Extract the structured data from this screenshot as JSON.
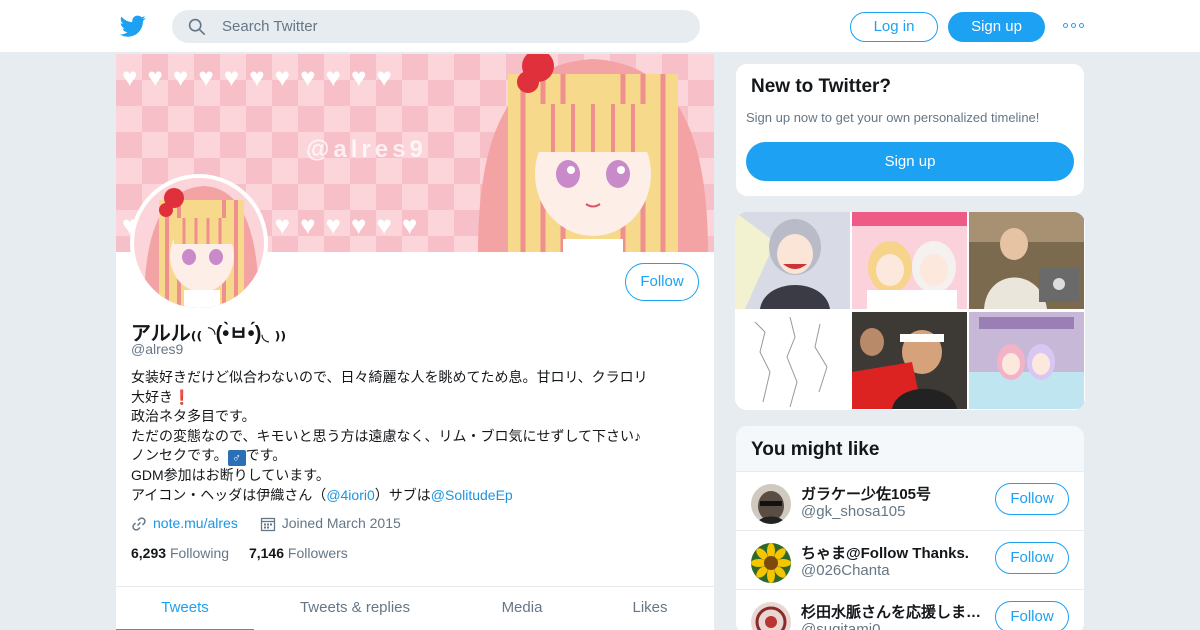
{
  "colors": {
    "accent": "#1da1f2",
    "link": "#1b95e0",
    "muted": "#657786",
    "text": "#14171a",
    "background": "#e6ecf0"
  },
  "topbar": {
    "logo_icon": "twitter-bird-icon",
    "search_placeholder": "Search Twitter",
    "login_label": "Log in",
    "signup_label": "Sign up",
    "more_icon": "more-dots-icon"
  },
  "banner": {
    "watermark": "@alres9"
  },
  "profile": {
    "follow_label": "Follow",
    "name": "アルル₍₍ ◝(•̀ㅂ•́)◟ ₎₎",
    "handle": "@alres9",
    "bio": {
      "line1": "女装好きだけど似合わないので、日々綺麗な人を眺めてため息。甘ロリ、クラロリ",
      "line2": "大好き",
      "line2_emoji": "❗",
      "line3": "政治ネタ多目です。",
      "line4": "ただの変態なので、キモいと思う方は遠慮なく、リム・ブロ気にせずして下さい♪",
      "line5a": "ノンセクです。",
      "line5_emoji": "♂",
      "line5b": "です。",
      "line6": "GDM参加はお断りしています。",
      "line7a": "アイコン・ヘッダは伊織さん（",
      "line7_link1": "@4iori0",
      "line7b": "）サブは",
      "line7_link2": "@SolitudeEp"
    },
    "website": "note.mu/alres",
    "joined": "Joined March 2015",
    "following_count": "6,293",
    "following_label": "Following",
    "followers_count": "7,146",
    "followers_label": "Followers"
  },
  "tabs": [
    {
      "label": "Tweets",
      "active": true
    },
    {
      "label": "Tweets & replies",
      "active": false
    },
    {
      "label": "Media",
      "active": false
    },
    {
      "label": "Likes",
      "active": false
    }
  ],
  "new_to_twitter": {
    "title": "New to Twitter?",
    "subtitle": "Sign up now to get your own personalized timeline!",
    "button": "Sign up"
  },
  "media_thumbs": [
    {
      "name": "media-thumb-anime-girl"
    },
    {
      "name": "media-thumb-nurse-girls-poster"
    },
    {
      "name": "media-thumb-man-kimono-laptop"
    },
    {
      "name": "media-thumb-ascii-art"
    },
    {
      "name": "media-thumb-crowd-politician"
    },
    {
      "name": "media-thumb-anime-room"
    }
  ],
  "you_might_like": {
    "title": "You might like",
    "accounts": [
      {
        "name": "ガラケー少佐105号",
        "handle": "@gk_shosa105",
        "follow": "Follow"
      },
      {
        "name": "ちゃま@Follow Thanks.",
        "handle": "@026Chanta",
        "follow": "Follow"
      },
      {
        "name": "杉田水脈さんを応援しま…",
        "handle": "@sugitamj0",
        "follow": "Follow"
      }
    ]
  }
}
